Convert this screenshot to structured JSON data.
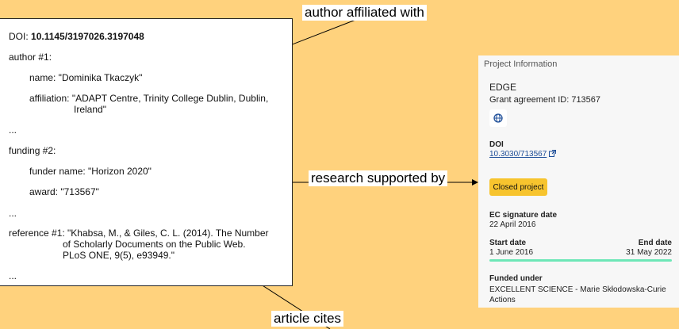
{
  "labels": {
    "author": "author affiliated with",
    "research": "research supported by",
    "article": "article cites"
  },
  "metadata": {
    "doi_label": "DOI:",
    "doi_value": "10.1145/3197026.3197048",
    "author_header": "author #1:",
    "author_name": "name: \"Dominika Tkaczyk\"",
    "affiliation_line1": "affiliation: \"ADAPT Centre, Trinity College Dublin, Dublin,",
    "affiliation_line2": "Ireland\"",
    "ellipsis1": "...",
    "funding_header": "funding #2:",
    "funder_name": "funder name: \"Horizon 2020\"",
    "award": "award: \"713567\"",
    "ellipsis2": "...",
    "reference_line1": "reference #1: \"Khabsa, M., & Giles, C. L. (2014). The Number",
    "reference_line2": "of Scholarly Documents on the Public Web.",
    "reference_line3": "PLoS ONE, 9(5), e93949.\"",
    "ellipsis3": "..."
  },
  "project": {
    "panel_title": "Project Information",
    "name": "EDGE",
    "grant": "Grant agreement ID: 713567",
    "globe_icon": "globe-icon",
    "doi_label": "DOI",
    "doi_value": "10.3030/713567",
    "external_icon": "external-link-icon",
    "status_button": "Closed project",
    "ec_sig_label": "EC signature date",
    "ec_sig_value": "22 April 2016",
    "start_label": "Start date",
    "start_value": "1 June 2016",
    "end_label": "End date",
    "end_value": "31 May 2022",
    "progress_fraction": 1.0,
    "funded_label": "Funded under",
    "funded_line1": "EXCELLENT SCIENCE - Marie Skłodowska-Curie",
    "funded_line2": "Actions"
  },
  "colors": {
    "background": "#ffd27d",
    "button": "#f7c42e",
    "progress": "#6ee7b7",
    "link": "#1f4f99"
  }
}
